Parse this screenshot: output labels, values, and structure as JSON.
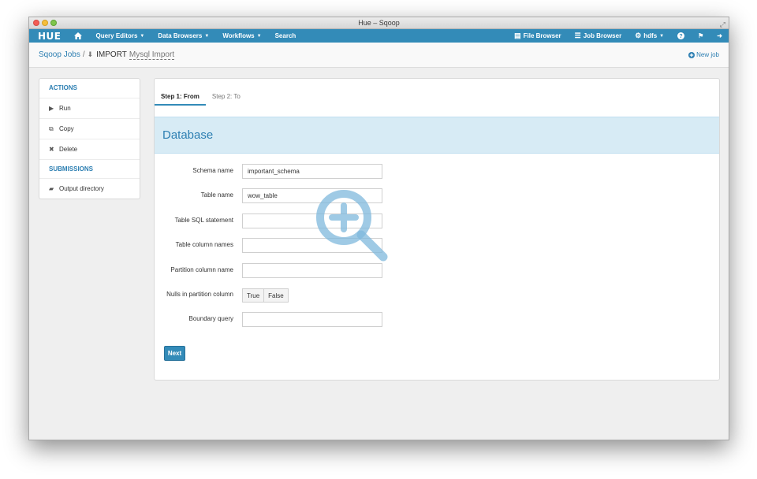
{
  "window": {
    "title": "Hue – Sqoop"
  },
  "navbar": {
    "logo": "HUE",
    "items": [
      {
        "label": "Query Editors",
        "has_dropdown": true
      },
      {
        "label": "Data Browsers",
        "has_dropdown": true
      },
      {
        "label": "Workflows",
        "has_dropdown": true
      },
      {
        "label": "Search",
        "has_dropdown": false
      }
    ],
    "right": {
      "file_browser": "File Browser",
      "job_browser": "Job Browser",
      "user": "hdfs"
    }
  },
  "breadcrumb": {
    "root": "Sqoop Jobs",
    "separator": "/",
    "job_type": "IMPORT",
    "job_name": "Mysql Import",
    "new_job": "New job"
  },
  "sidebar": {
    "actions_header": "ACTIONS",
    "actions": [
      "Run",
      "Copy",
      "Delete"
    ],
    "submissions_header": "SUBMISSIONS",
    "submissions": [
      "Output directory"
    ]
  },
  "wizard": {
    "steps": [
      {
        "label": "Step 1: From",
        "active": true
      },
      {
        "label": "Step 2: To",
        "active": false
      }
    ],
    "section_title": "Database",
    "fields": [
      {
        "label": "Schema name",
        "value": "important_schema"
      },
      {
        "label": "Table name",
        "value": "wow_table"
      },
      {
        "label": "Table SQL statement",
        "value": ""
      },
      {
        "label": "Table column names",
        "value": ""
      },
      {
        "label": "Partition column name",
        "value": ""
      }
    ],
    "nulls_label": "Nulls in partition column",
    "nulls_options": [
      "True",
      "False"
    ],
    "boundary_label": "Boundary query",
    "boundary_value": "",
    "next_label": "Next"
  },
  "colors": {
    "nav_blue": "#338bb8",
    "banner": "#d7ebf5",
    "link": "#2d7fb2"
  },
  "icons": {
    "home": "home-icon",
    "file": "file-icon",
    "job": "list-icon",
    "user": "gears-icon",
    "help": "question-icon",
    "flag": "flag-icon",
    "logout": "sign-out-icon",
    "zoom": "zoom-in-icon"
  }
}
